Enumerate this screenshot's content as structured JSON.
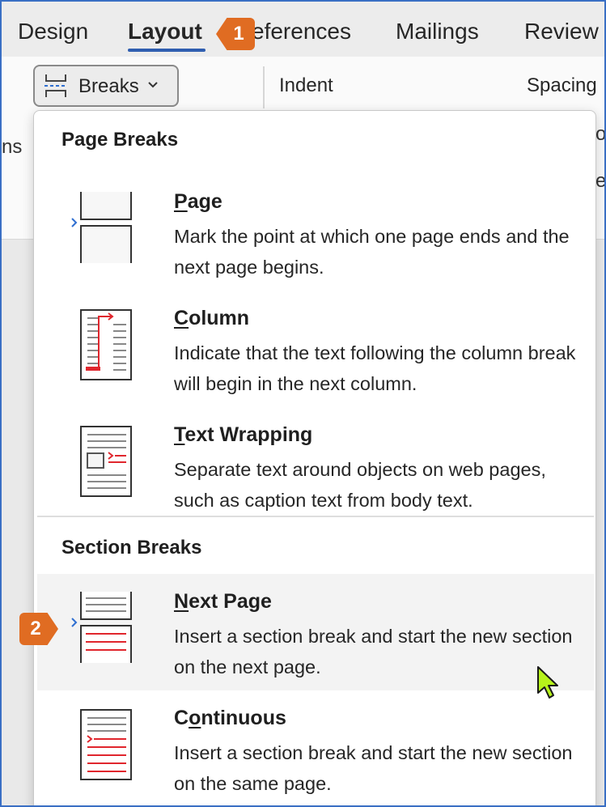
{
  "ribbon_tabs": {
    "design": "Design",
    "layout": "Layout",
    "references": "eferences",
    "mailings": "Mailings",
    "review": "Review"
  },
  "ribbon": {
    "breaks_label": "Breaks",
    "indent_label": "Indent",
    "spacing_label": "Spacing",
    "left_clipped_text": "ns",
    "right_clipped_1": "o",
    "right_clipped_2": "e"
  },
  "menu": {
    "page_breaks_title": "Page Breaks",
    "section_breaks_title": "Section Breaks",
    "items": [
      {
        "key_letter": "P",
        "title_rest": "age",
        "description": "Mark the point at which one page ends and the next page begins.",
        "icon": "page-break-icon"
      },
      {
        "key_letter": "C",
        "title_rest": "olumn",
        "description": "Indicate that the text following the column break will begin in the next column.",
        "icon": "column-break-icon"
      },
      {
        "key_letter": "T",
        "title_rest": "ext Wrapping",
        "description": "Separate text around objects on web pages, such as caption text from body text.",
        "icon": "text-wrapping-icon"
      },
      {
        "key_letter": "N",
        "title_rest": "ext Page",
        "description": "Insert a section break and start the new section on the next page.",
        "icon": "next-page-section-icon"
      },
      {
        "title_pre": "C",
        "key_letter": "o",
        "title_rest": "ntinuous",
        "description": "Insert a section break and start the new section on the same page.",
        "icon": "continuous-section-icon"
      }
    ]
  },
  "callouts": {
    "step1": "1",
    "step2": "2"
  },
  "colors": {
    "accent_orange": "#e06c22",
    "accent_blue": "#2f5eb0",
    "icon_red": "#e0262d"
  }
}
